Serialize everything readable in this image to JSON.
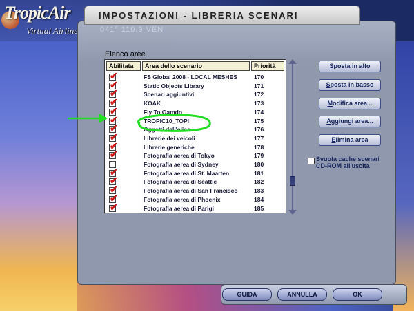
{
  "logo": {
    "main": "TropicAir",
    "sub": "Virtual Airline"
  },
  "window": {
    "title": "IMPOSTAZIONI - LIBRERIA SCENARI"
  },
  "map_overlay_text": "041° 110.9 VEN",
  "section_label": "Elenco aree",
  "columns": {
    "enabled": "Abilitata",
    "area": "Area dello scenario",
    "priority": "Priorità"
  },
  "rows": [
    {
      "name": "FS Global 2008 - LOCAL MESHES",
      "priority": "170",
      "enabled": true
    },
    {
      "name": "Static Objects Library",
      "priority": "171",
      "enabled": true
    },
    {
      "name": "Scenari aggiuntivi",
      "priority": "172",
      "enabled": true
    },
    {
      "name": "KOAK",
      "priority": "173",
      "enabled": true
    },
    {
      "name": "Fly To Qamdo",
      "priority": "174",
      "enabled": true
    },
    {
      "name": "TROPIC10_TOPI",
      "priority": "175",
      "enabled": true
    },
    {
      "name": "Oggetti dell'elica",
      "priority": "176",
      "enabled": true
    },
    {
      "name": "Librerie dei veicoli",
      "priority": "177",
      "enabled": true
    },
    {
      "name": "Librerie generiche",
      "priority": "178",
      "enabled": true
    },
    {
      "name": "Fotografia aerea di Tokyo",
      "priority": "179",
      "enabled": true
    },
    {
      "name": "Fotografia aerea di Sydney",
      "priority": "180",
      "enabled": false
    },
    {
      "name": "Fotografia aerea di St. Maarten",
      "priority": "181",
      "enabled": true
    },
    {
      "name": "Fotografia aerea di Seattle",
      "priority": "182",
      "enabled": true
    },
    {
      "name": "Fotografia aerea di San Francisco",
      "priority": "183",
      "enabled": true
    },
    {
      "name": "Fotografia aerea di Phoenix",
      "priority": "184",
      "enabled": true
    },
    {
      "name": "Fotografia aerea di Parigi",
      "priority": "185",
      "enabled": true
    }
  ],
  "buttons": {
    "move_up": "Sposta in alto",
    "move_down": "Sposta in basso",
    "edit": "Modifica area...",
    "add": "Aggiungi area...",
    "delete": "Elimina area"
  },
  "option": {
    "clear_cache": "Svuota cache scenari CD-ROM all'uscita",
    "checked": false
  },
  "bottom": {
    "help": "GUIDA",
    "cancel": "ANNULLA",
    "ok": "OK"
  },
  "colors": {
    "check": "#d21414",
    "annotation": "#22dd22",
    "scroll": "#5d6590"
  },
  "scroll_position": 0.82
}
